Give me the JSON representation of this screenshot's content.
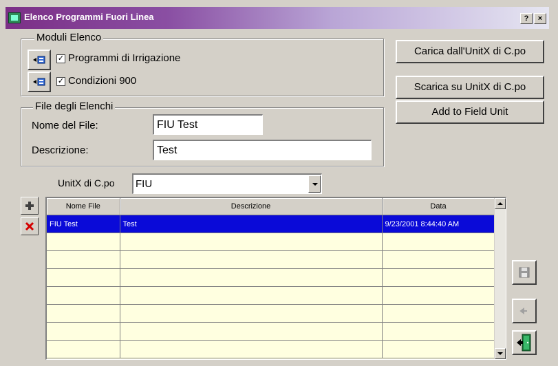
{
  "window": {
    "title": "Elenco Programmi Fuori Linea",
    "help_label": "?",
    "close_label": "×"
  },
  "moduli": {
    "label": "Moduli Elenco",
    "items": [
      {
        "label": "Programmi di Irrigazione",
        "checked": "✓"
      },
      {
        "label": "Condizioni 900",
        "checked": "✓"
      }
    ]
  },
  "buttons": {
    "carica": "Carica dall'UnitX di C.po",
    "scarica": "Scarica su UnitX di C.po",
    "add_field": "Add to Field Unit"
  },
  "file": {
    "label": "File degli Elenchi",
    "name_label": "Nome del File:",
    "name_value": "FIU Test",
    "desc_label": "Descrizione:",
    "desc_value": "Test"
  },
  "unit": {
    "label": "UnitX di C.po",
    "value": "FIU"
  },
  "grid": {
    "columns": [
      "Nome File",
      "Descrizione",
      "Data"
    ],
    "rows": [
      [
        "FIU Test",
        "Test",
        "9/23/2001 8:44:40 AM"
      ],
      [
        "",
        "",
        ""
      ],
      [
        "",
        "",
        ""
      ],
      [
        "",
        "",
        ""
      ],
      [
        "",
        "",
        ""
      ],
      [
        "",
        "",
        ""
      ],
      [
        "",
        "",
        ""
      ],
      [
        "",
        "",
        ""
      ]
    ]
  },
  "side_icons": {
    "add": "add-row-icon",
    "delete": "delete-icon",
    "save": "save-icon",
    "undo": "undo-icon",
    "exit": "exit-door-icon"
  },
  "colors": {
    "selection": "#0a0ad8",
    "grid_bg": "#ffffe0",
    "delete_red": "#d40000",
    "exit_green": "#1a7a3a"
  }
}
